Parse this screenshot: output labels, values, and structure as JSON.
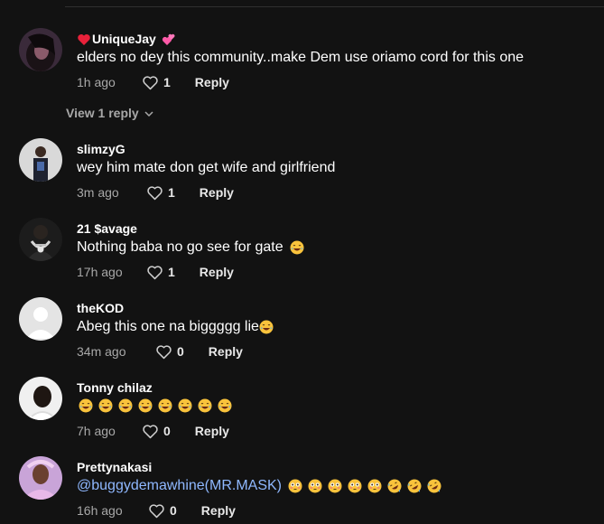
{
  "comments": [
    {
      "username": "UniqueJay",
      "prefix_icon": "heart-emoji",
      "suffix_icon": "two-hearts-emoji",
      "text": "elders no dey this community..make Dem use oriamo cord for this one",
      "time": "1h ago",
      "likes": "1",
      "reply_label": "Reply",
      "view_replies": "View 1 reply"
    },
    {
      "username": "slimzyG",
      "text": "wey him mate don get wife and girlfriend",
      "time": "3m ago",
      "likes": "1",
      "reply_label": "Reply"
    },
    {
      "username": "21 $avage",
      "text": "Nothing baba no go see for gate",
      "emojis": [
        "laughing-face"
      ],
      "time": "17h ago",
      "likes": "1",
      "reply_label": "Reply"
    },
    {
      "username": "theKOD",
      "text": "Abeg this one na biggggg lie",
      "emojis": [
        "laughing-face"
      ],
      "time": "34m ago",
      "likes": "0",
      "reply_label": "Reply"
    },
    {
      "username": "Tonny chilaz",
      "text": "",
      "emojis": [
        "laughing-face",
        "laughing-face",
        "laughing-face",
        "laughing-face",
        "laughing-face",
        "laughing-face",
        "laughing-face",
        "laughing-face"
      ],
      "time": "7h ago",
      "likes": "0",
      "reply_label": "Reply"
    },
    {
      "username": "Prettynakasi",
      "mention": "@buggydemawhine(MR.MASK)",
      "emojis": [
        "flushed-face",
        "flushed-face",
        "flushed-face",
        "flushed-face",
        "flushed-face",
        "rofl-face",
        "rofl-face",
        "rofl-face"
      ],
      "time": "16h ago",
      "likes": "0",
      "reply_label": "Reply"
    }
  ],
  "colors": {
    "background": "#121212",
    "text": "#ffffff",
    "secondary": "#a8a8a8",
    "mention": "#8fb8ff",
    "heart": "#fe2c55"
  }
}
